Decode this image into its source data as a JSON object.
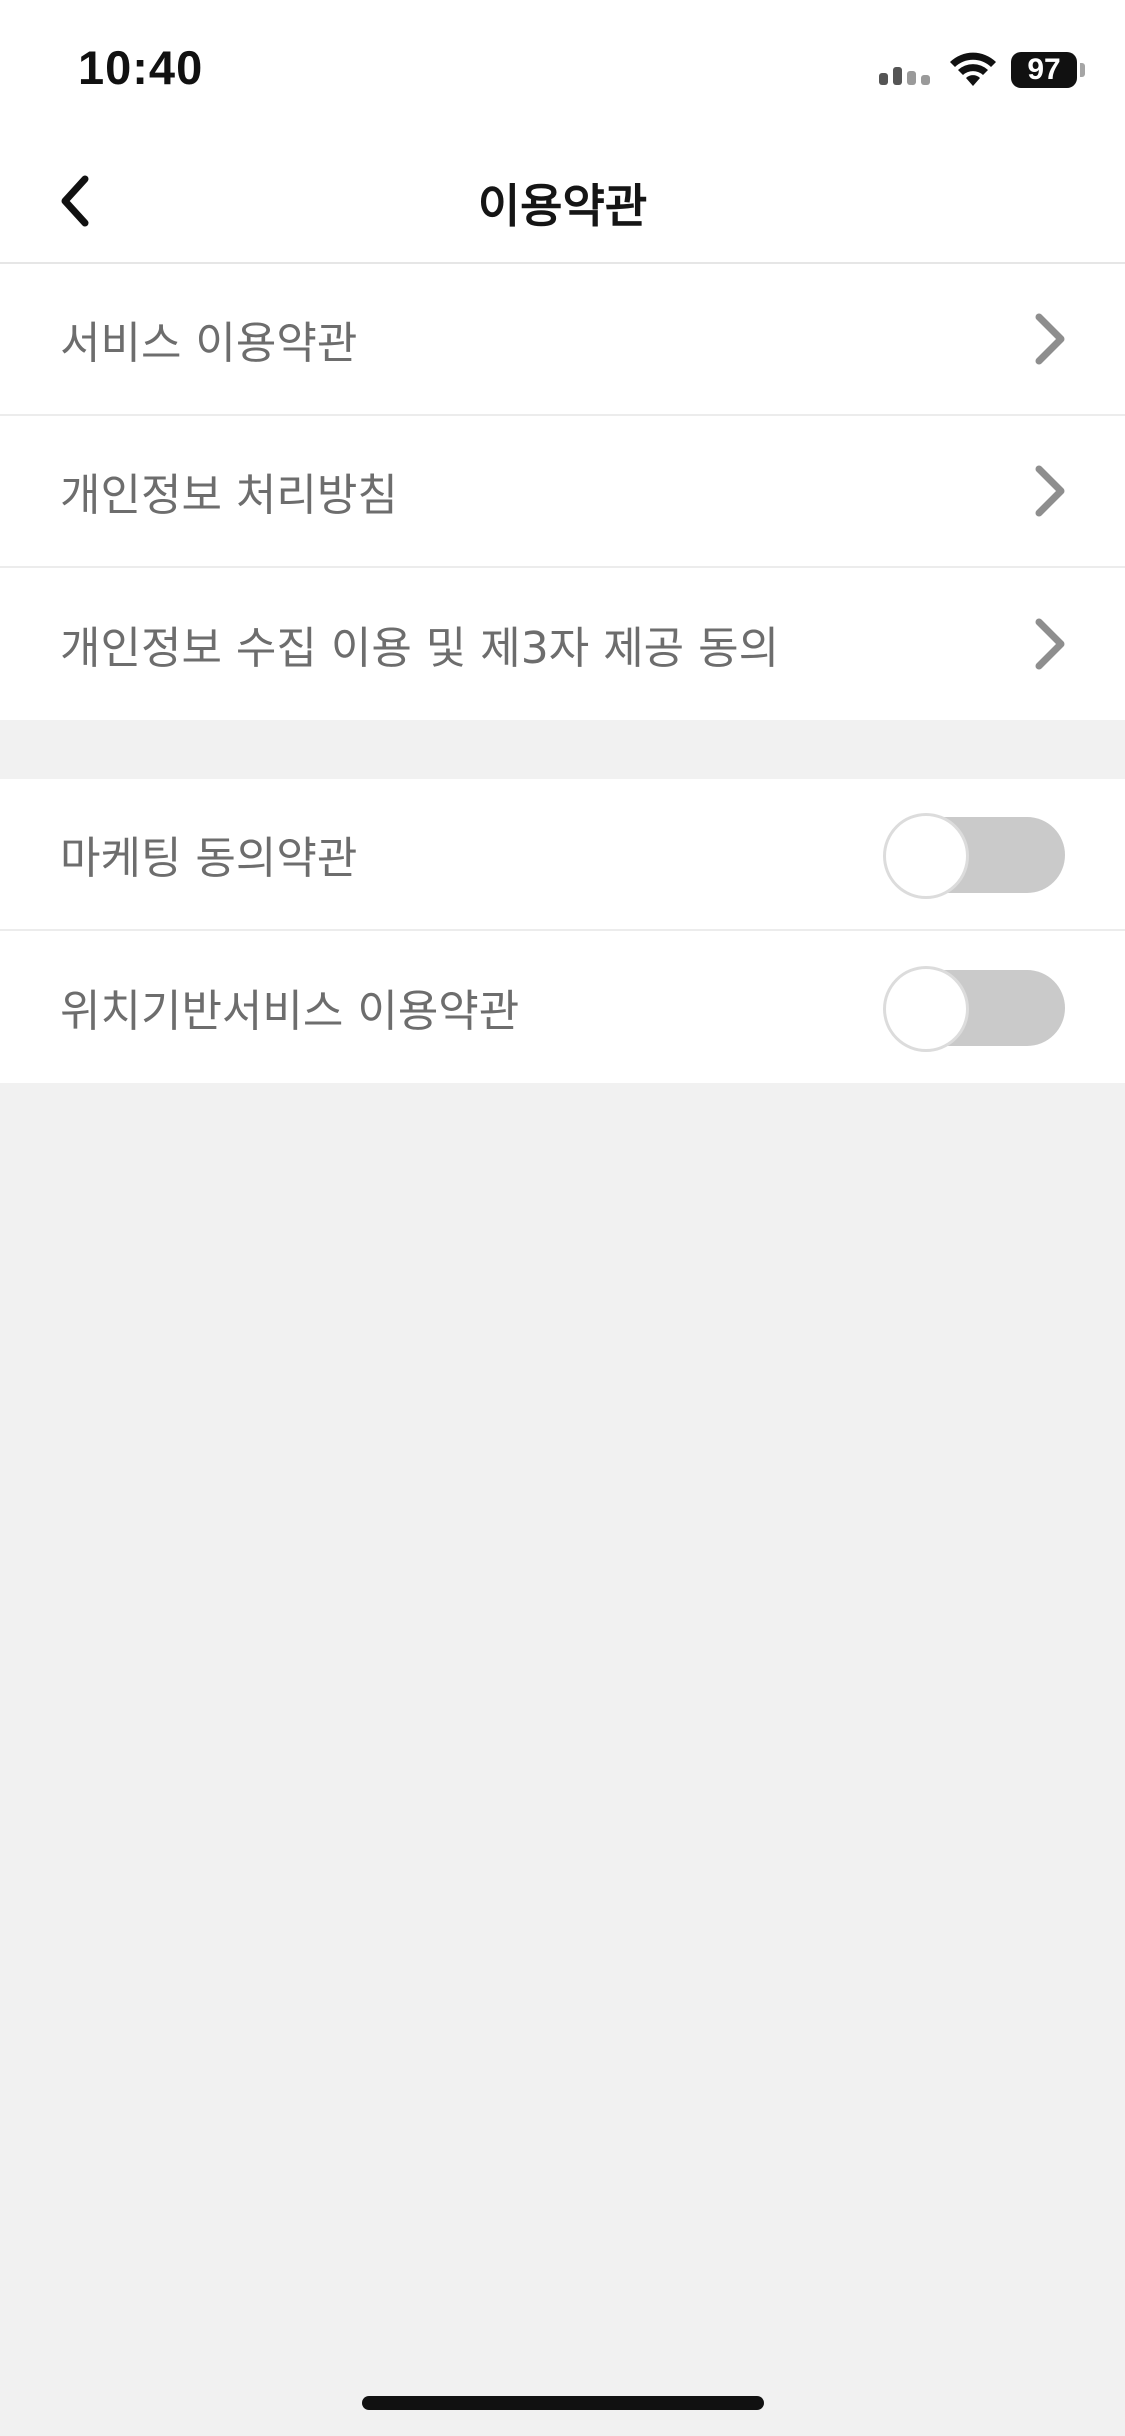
{
  "status_bar": {
    "time": "10:40",
    "battery": "97",
    "icons": [
      "signal-icon",
      "wifi-icon",
      "battery-icon"
    ]
  },
  "nav": {
    "back_icon": "chevron-left-icon",
    "title": "이용약관"
  },
  "terms_list": [
    {
      "label": "서비스 이용약관",
      "icon": "chevron-right-icon"
    },
    {
      "label": "개인정보 처리방침",
      "icon": "chevron-right-icon"
    },
    {
      "label": "개인정보 수집 이용 및 제3자 제공 동의",
      "icon": "chevron-right-icon"
    }
  ],
  "consent_list": [
    {
      "label": "마케팅 동의약관",
      "toggle_on": false
    },
    {
      "label": "위치기반서비스 이용약관",
      "toggle_on": false
    }
  ],
  "colors": {
    "background": "#f1f1f1",
    "row_text": "#6d6d6d",
    "toggle_off": "#cacaca",
    "chevron": "#8e8e8e"
  }
}
